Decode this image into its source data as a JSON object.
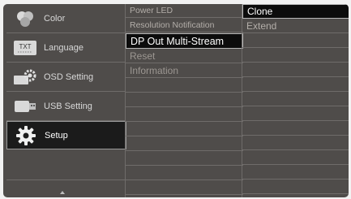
{
  "menu": {
    "items": [
      {
        "label": "Color",
        "icon": "color-circles-icon"
      },
      {
        "label": "Language",
        "icon": "txt-language-icon"
      },
      {
        "label": "OSD Setting",
        "icon": "osd-gear-icon"
      },
      {
        "label": "USB Setting",
        "icon": "usb-plug-icon"
      },
      {
        "label": "Setup",
        "icon": "setup-gear-icon",
        "active": true
      }
    ],
    "language_icon_text": "TXT",
    "scroll_indicator": "up-arrow-icon"
  },
  "submenu": {
    "items": [
      {
        "label": "Power LED"
      },
      {
        "label": "Resolution Notification"
      },
      {
        "label": "DP Out Multi-Stream",
        "selected": true
      },
      {
        "label": "Reset"
      },
      {
        "label": "Information"
      }
    ]
  },
  "options": {
    "items": [
      {
        "label": "Clone",
        "selected": true
      },
      {
        "label": "Extend"
      }
    ]
  },
  "colors": {
    "panel_bg": "#4f4c4a",
    "selected_bg": "#0c0c0c",
    "text_muted": "#b3aea9",
    "text_selected": "#ffffff"
  }
}
